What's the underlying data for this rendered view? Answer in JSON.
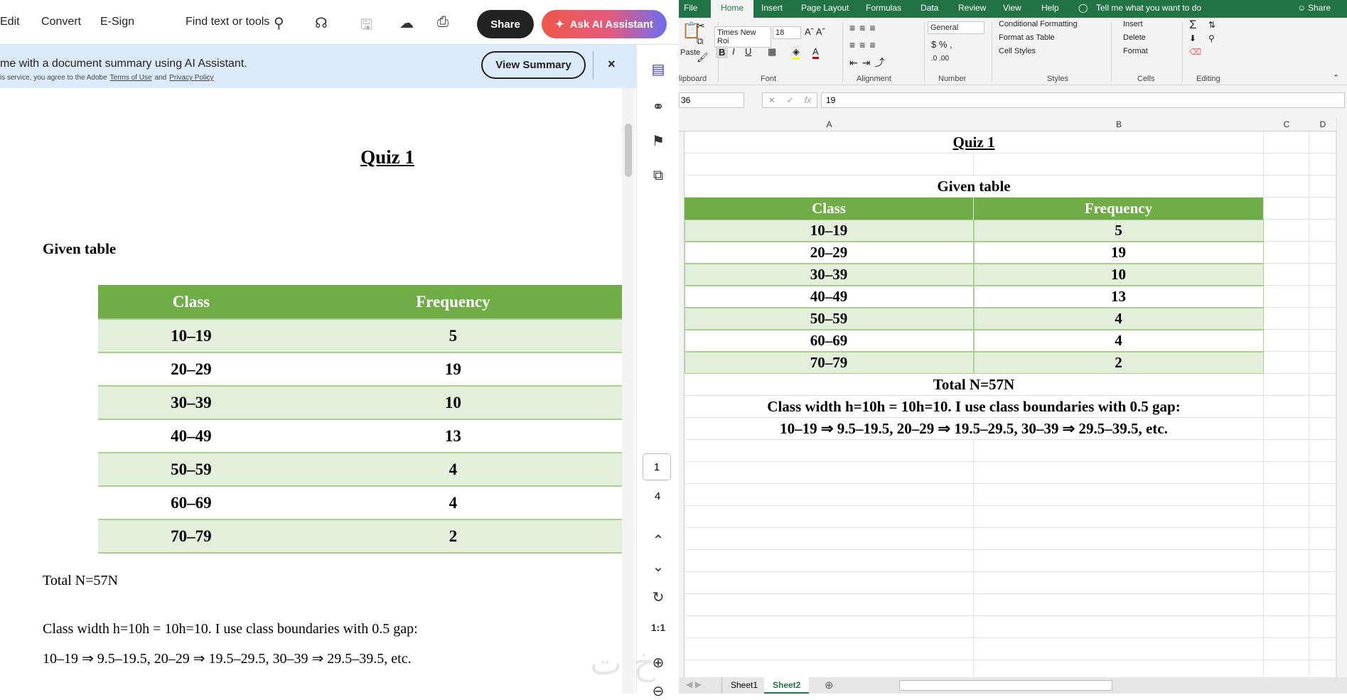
{
  "acrobat": {
    "menu": [
      "Edit",
      "Convert",
      "E-Sign"
    ],
    "find_label": "Find text or tools",
    "share_label": "Share",
    "ask_ai_label": "Ask AI Assistant",
    "banner": {
      "message": "me with a document summary using AI Assistant.",
      "legal_prefix": "is service, you agree to the Adobe",
      "terms": "Terms of Use",
      "and": "and",
      "privacy": "Privacy Policy",
      "view_summary": "View Summary",
      "close": "×"
    },
    "page": {
      "current": "1",
      "total": "4"
    },
    "doc": {
      "title": "Quiz 1",
      "subtitle": "Given table",
      "headers": [
        "Class",
        "Frequency"
      ],
      "rows": [
        [
          "10–19",
          "5"
        ],
        [
          "20–29",
          "19"
        ],
        [
          "30–39",
          "10"
        ],
        [
          "40–49",
          "13"
        ],
        [
          "50–59",
          "4"
        ],
        [
          "60–69",
          "4"
        ],
        [
          "70–79",
          "2"
        ]
      ],
      "total": "Total N=57N",
      "width_line": "Class width h=10h = 10h=10. I use class boundaries with 0.5 gap:",
      "boundaries": "10–19 ⇒ 9.5–19.5, 20–29 ⇒ 19.5–29.5, 30–39 ⇒ 29.5–39.5, etc."
    }
  },
  "excel": {
    "tabs": [
      "File",
      "Home",
      "Insert",
      "Page Layout",
      "Formulas",
      "Data",
      "Review",
      "View",
      "Help"
    ],
    "tell_me": "Tell me what you want to do",
    "share": "Share",
    "ribbon": {
      "paste": "Paste",
      "font_name": "Times New Roi",
      "font_size": "18",
      "number_format": "General",
      "cond_fmt": "Conditional Formatting",
      "fmt_table": "Format as Table",
      "cell_styles": "Cell Styles",
      "insert": "Insert",
      "delete": "Delete",
      "format": "Format",
      "groups": [
        "lipboard",
        "Font",
        "Alignment",
        "Number",
        "Styles",
        "Cells",
        "Editing"
      ]
    },
    "name_box": "36",
    "formula": "19",
    "fx": "fx",
    "columns": [
      "A",
      "B",
      "C",
      "D"
    ],
    "cells": {
      "title": "Quiz 1",
      "subtitle": "Given table",
      "total": "Total N=57N",
      "width_line": "Class width h=10h = 10h=10. I use class boundaries with 0.5 gap:",
      "boundaries": "10–19 ⇒ 9.5–19.5, 20–29 ⇒ 19.5–29.5, 30–39 ⇒ 29.5–39.5, etc."
    },
    "sheets": [
      "Sheet1",
      "Sheet2"
    ],
    "active_sheet": "Sheet2",
    "colors": {
      "green": "#217346",
      "header": "#70ad47",
      "band": "#e2efda"
    }
  }
}
